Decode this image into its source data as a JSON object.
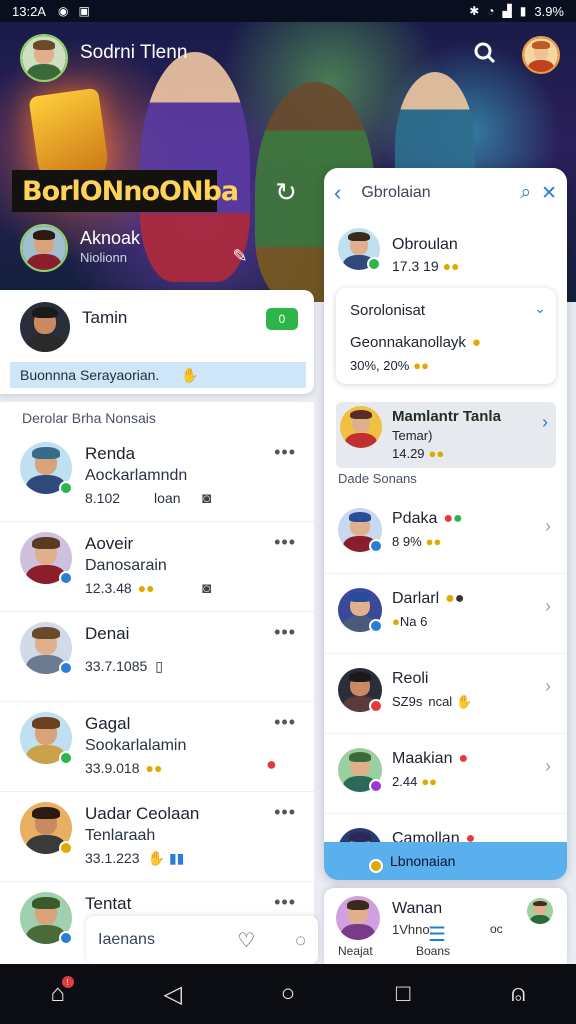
{
  "status_bar": {
    "time": "13:2A",
    "battery": "3.9%"
  },
  "hero": {
    "title_name": "Sodrni Tlenn",
    "banner_text": "BorlONnoONba",
    "profile_name": "Aknoak",
    "profile_sub": "Niolionn"
  },
  "card_tamin": {
    "name": "Tamin",
    "strip_text": "Buonnna Serayaorian.",
    "toggle_label": "0"
  },
  "left_list": {
    "section_title": "Derolar Brha Nonsais",
    "rows": [
      {
        "name": "Renda",
        "sub": "Aockarlamndn",
        "meta": "8.102",
        "meta2": "loan",
        "colors": {
          "skin": "#d9a27a",
          "hair": "#3a6a8a",
          "shirt": "#2d4a7a",
          "badge": "#2db54a"
        }
      },
      {
        "name": "Aoveir",
        "sub": "Danosarain",
        "meta": "12.3.48",
        "colors": {
          "skin": "#e0b08c",
          "hair": "#5a3a20",
          "shirt": "#8a1e2a",
          "badge": "#2a7fd4"
        }
      },
      {
        "name": "Denai",
        "sub": "",
        "meta": "33.7.1085",
        "colors": {
          "skin": "#e0b08c",
          "hair": "#6a4a2a",
          "shirt": "#6a7a90",
          "badge": "#2a7fd4"
        }
      },
      {
        "name": "Gagal",
        "sub": "Sookarlalamin",
        "meta": "33.9.018",
        "colors": {
          "skin": "#d9a27a",
          "hair": "#6a4020",
          "shirt": "#c9a24a",
          "badge": "#2db54a"
        }
      },
      {
        "name": "Uadar Ceolaan",
        "sub": "Tenlaraah",
        "meta": "33.1.223",
        "colors": {
          "skin": "#c98a62",
          "hair": "#2a1a10",
          "shirt": "#3a3a3a",
          "badge": "#e0a800"
        }
      },
      {
        "name": "Tentat",
        "sub": "",
        "meta": "",
        "colors": {
          "skin": "#d9a27a",
          "hair": "#3a5a2a",
          "shirt": "#4a6a3a",
          "badge": "#2a7fd4"
        }
      }
    ]
  },
  "compose": {
    "placeholder": "Iaenans"
  },
  "right_panel": {
    "header_title": "Gbrolaian",
    "user": {
      "name": "Obroulan",
      "meta": "17.3 19"
    },
    "dropdown": {
      "title": "Sorolonisat",
      "line2": "Geonnakanollayk",
      "line3": "30%, 20%"
    },
    "featured": {
      "name": "Mamlantr Tanla",
      "sub": "Temar)",
      "meta": "14.29"
    },
    "section_title": "Dade Sonans",
    "rows": [
      {
        "name": "Pdaka",
        "meta": "8 9%",
        "colors": {
          "skin": "#e0b08c",
          "hair": "#2a4a9a",
          "shirt": "#8a1e2a",
          "badge": "#2a7fd4"
        }
      },
      {
        "name": "Darlarl",
        "meta": "Na 6",
        "colors": {
          "skin": "#e0b08c",
          "hair": "#2a4a9a",
          "shirt": "#4a5a7a",
          "badge": "#2a7fd4"
        }
      },
      {
        "name": "Reoli",
        "meta": "SZ9s",
        "meta2": "ncal",
        "colors": {
          "skin": "#c98a62",
          "hair": "#1a1a1a",
          "shirt": "#5a3a3a",
          "badge": "#e23b3b"
        }
      },
      {
        "name": "Maakian",
        "meta": "2.44",
        "colors": {
          "skin": "#e0b08c",
          "hair": "#3a6a3a",
          "shirt": "#2a6a5a",
          "badge": "#9a3ad4"
        }
      },
      {
        "name": "Camollan",
        "meta": "",
        "colors": {
          "skin": "#e0b08c",
          "hair": "#2a2a5a",
          "shirt": "#3a4a7a",
          "badge": "#e0a800"
        }
      }
    ],
    "strip_text": "Lbnonaian"
  },
  "right_bottom": {
    "name": "Wanan",
    "sub": "1Vhno",
    "tabs": [
      "Neajat",
      "Boans",
      "oc"
    ]
  },
  "icons": {
    "search": "search-icon",
    "back": "chevron-left-icon",
    "close": "close-icon",
    "home": "home-icon",
    "back_nav": "back-icon",
    "home_nav": "circle-home-icon",
    "recents": "recents-icon",
    "account": "account-icon"
  },
  "colors": {
    "accent": "#2a7fd4",
    "positive": "#2db54a",
    "strip": "#5ab0ec"
  }
}
